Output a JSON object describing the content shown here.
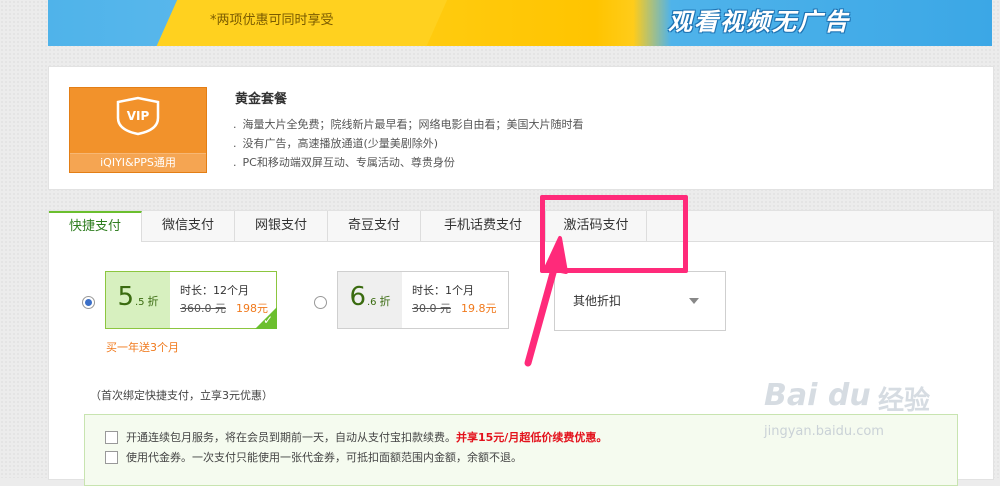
{
  "banner": {
    "sub": "*两项优惠可同时享受",
    "slogan": "观看视频无广告"
  },
  "package": {
    "logo_text": "VIP",
    "logo_caption": "iQIYI&PPS通用",
    "title": "黄金套餐",
    "features": [
      "海量大片全免费；院线新片最早看；网络电影自由看；美国大片随时看",
      "没有广告，高速播放通道(少量美剧除外)",
      "PC和移动端双屏互动、专属活动、尊贵身份"
    ]
  },
  "tabs": [
    {
      "label": "快捷支付",
      "active": true
    },
    {
      "label": "微信支付",
      "active": false
    },
    {
      "label": "网银支付",
      "active": false
    },
    {
      "label": "奇豆支付",
      "active": false
    },
    {
      "label": "手机话费支付",
      "active": false
    },
    {
      "label": "激活码支付",
      "active": false
    }
  ],
  "options": [
    {
      "disc_int": "5",
      "disc_dec": ".5",
      "zhe": "折",
      "duration": "时长：12个月",
      "old_price": "360.0 元",
      "new_price": "198元",
      "selected": true
    },
    {
      "disc_int": "6",
      "disc_dec": ".6",
      "zhe": "折",
      "duration": "时长：1个月",
      "old_price": "30.0 元",
      "new_price": "19.8元",
      "selected": false
    }
  ],
  "gift": "买一年送3个月",
  "dropdown": {
    "label": "其他折扣"
  },
  "note": "（首次绑定快捷支付，立享3元优惠）",
  "agreements": [
    {
      "text": "开通连续包月服务，将在会员到期前一天，自动从支付宝扣款续费。",
      "highlight": "并享15元/月超低价续费优惠。"
    },
    {
      "text": "使用代金券。一次支付只能使用一张代金券，可抵扣面额范围内金额，余额不退。",
      "highlight": ""
    }
  ],
  "watermark": {
    "brand": "Bai du",
    "cn": "经验",
    "url": "jingyan.baidu.com"
  },
  "colors": {
    "accent_green": "#6bbf2e",
    "vip_orange": "#f2922b",
    "annotation_pink": "#ff2a7a"
  }
}
